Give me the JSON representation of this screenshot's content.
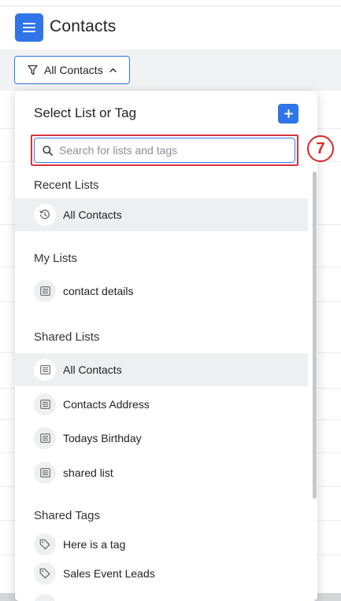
{
  "header": {
    "title": "Contacts",
    "menu_icon": "hamburger-menu-icon"
  },
  "toolbar": {
    "filter_label": "All Contacts"
  },
  "dropdown": {
    "title": "Select List or Tag",
    "search": {
      "placeholder": "Search for lists and tags",
      "value": ""
    },
    "sections": {
      "recent": {
        "heading": "Recent Lists",
        "items": [
          {
            "label": "All Contacts",
            "icon": "history-icon"
          }
        ]
      },
      "my_lists": {
        "heading": "My Lists",
        "items": [
          {
            "label": "contact details",
            "icon": "list-icon"
          }
        ]
      },
      "shared_lists": {
        "heading": "Shared Lists",
        "items": [
          {
            "label": "All Contacts",
            "icon": "list-icon"
          },
          {
            "label": "Contacts Address",
            "icon": "list-icon"
          },
          {
            "label": "Todays Birthday",
            "icon": "list-icon"
          },
          {
            "label": "shared list",
            "icon": "list-icon"
          }
        ]
      },
      "shared_tags": {
        "heading": "Shared Tags",
        "items": [
          {
            "label": "Here is a tag",
            "icon": "tag-icon"
          },
          {
            "label": "Sales Event Leads",
            "icon": "tag-icon"
          }
        ]
      }
    }
  },
  "annotation": {
    "step_number": "7"
  },
  "colors": {
    "accent": "#2f74e8",
    "highlight_red": "#d7323c"
  }
}
